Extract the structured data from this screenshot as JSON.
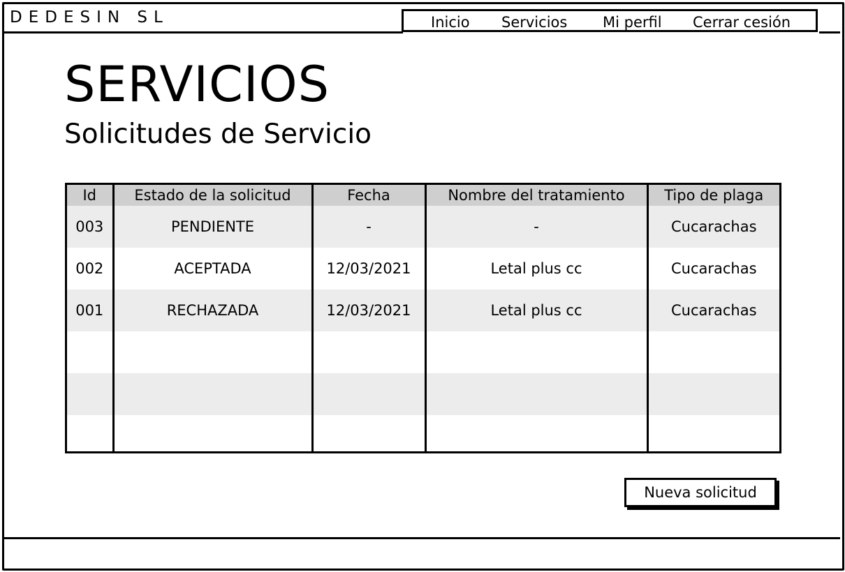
{
  "brand": "DEDESIN SL",
  "nav": {
    "items": [
      "Inicio",
      "Servicios",
      "Mi perfil",
      "Cerrar cesión"
    ]
  },
  "page": {
    "title": "SERVICIOS",
    "subtitle": "Solicitudes de Servicio"
  },
  "table": {
    "headers": [
      "Id",
      "Estado de la solicitud",
      "Fecha",
      "Nombre del tratamiento",
      "Tipo de plaga"
    ],
    "rows": [
      [
        "003",
        "PENDIENTE",
        "-",
        "-",
        "Cucarachas"
      ],
      [
        "002",
        "ACEPTADA",
        "12/03/2021",
        "Letal plus cc",
        "Cucarachas"
      ],
      [
        "001",
        "RECHAZADA",
        "12/03/2021",
        "Letal plus cc",
        "Cucarachas"
      ],
      [
        "",
        "",
        "",
        "",
        ""
      ],
      [
        "",
        "",
        "",
        "",
        ""
      ],
      [
        "",
        "",
        "",
        "",
        ""
      ]
    ]
  },
  "actions": {
    "new_request_label": "Nueva solicitud"
  }
}
